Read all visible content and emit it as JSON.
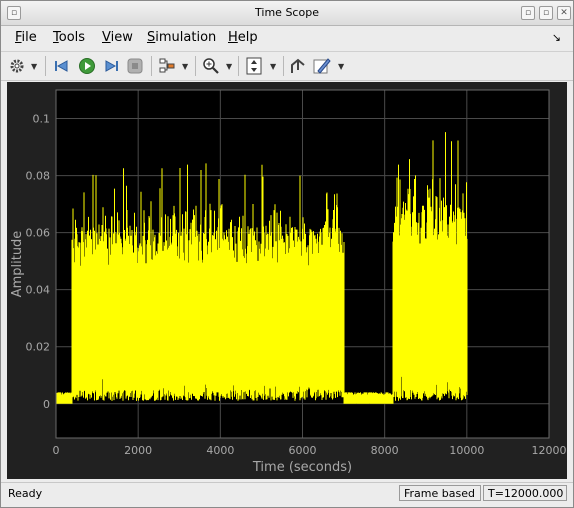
{
  "window": {
    "title": "Time Scope"
  },
  "menu": [
    {
      "label": "File",
      "accel": "F",
      "rest": "ile"
    },
    {
      "label": "Tools",
      "accel": "T",
      "rest": "ools"
    },
    {
      "label": "View",
      "accel": "V",
      "rest": "iew"
    },
    {
      "label": "Simulation",
      "accel": "S",
      "rest": "imulation"
    },
    {
      "label": "Help",
      "accel": "H",
      "rest": "elp"
    }
  ],
  "toolbar": {
    "icons": [
      "gear-icon",
      "step-back-icon",
      "run-icon",
      "step-forward-icon",
      "stop-icon",
      "layout-icon",
      "zoom-icon",
      "autoscale-icon",
      "restore-icon",
      "style-icon"
    ]
  },
  "status": {
    "left": "Ready",
    "mode": "Frame based",
    "time": "T=12000.000"
  },
  "colors": {
    "signal": "#ffff00",
    "plot_bg": "#000000",
    "panel_bg": "#212121",
    "grid": "#4a4a4a",
    "axis_text": "#a8a8a8"
  },
  "chart_data": {
    "type": "line",
    "title": "",
    "xlabel": "Time (seconds)",
    "ylabel": "Amplitude",
    "xlim": [
      0,
      12000
    ],
    "ylim": [
      -0.012,
      0.11
    ],
    "xticks": [
      0,
      2000,
      4000,
      6000,
      8000,
      10000,
      12000
    ],
    "yticks": [
      0,
      0.02,
      0.04,
      0.06,
      0.08,
      0.1
    ],
    "ytick_labels": [
      "0",
      "0.02",
      "0.04",
      "0.06",
      "0.08",
      "0.1"
    ],
    "grid": true,
    "series": [
      {
        "segments": [
          {
            "x_start": 0,
            "x_end": 400,
            "low": 0.0,
            "high": 0.004,
            "peak": 0.004
          },
          {
            "x_start": 400,
            "x_end": 7000,
            "low": 0.005,
            "high": 0.062,
            "peak": 0.085
          },
          {
            "x_start": 7000,
            "x_end": 8200,
            "low": 0.0,
            "high": 0.004,
            "peak": 0.004
          },
          {
            "x_start": 8200,
            "x_end": 10000,
            "low": 0.005,
            "high": 0.07,
            "peak": 0.097
          },
          {
            "x_start": 10000,
            "x_end": 12000,
            "low": 0.0,
            "high": 0.0,
            "peak": 0.0
          }
        ]
      }
    ]
  }
}
